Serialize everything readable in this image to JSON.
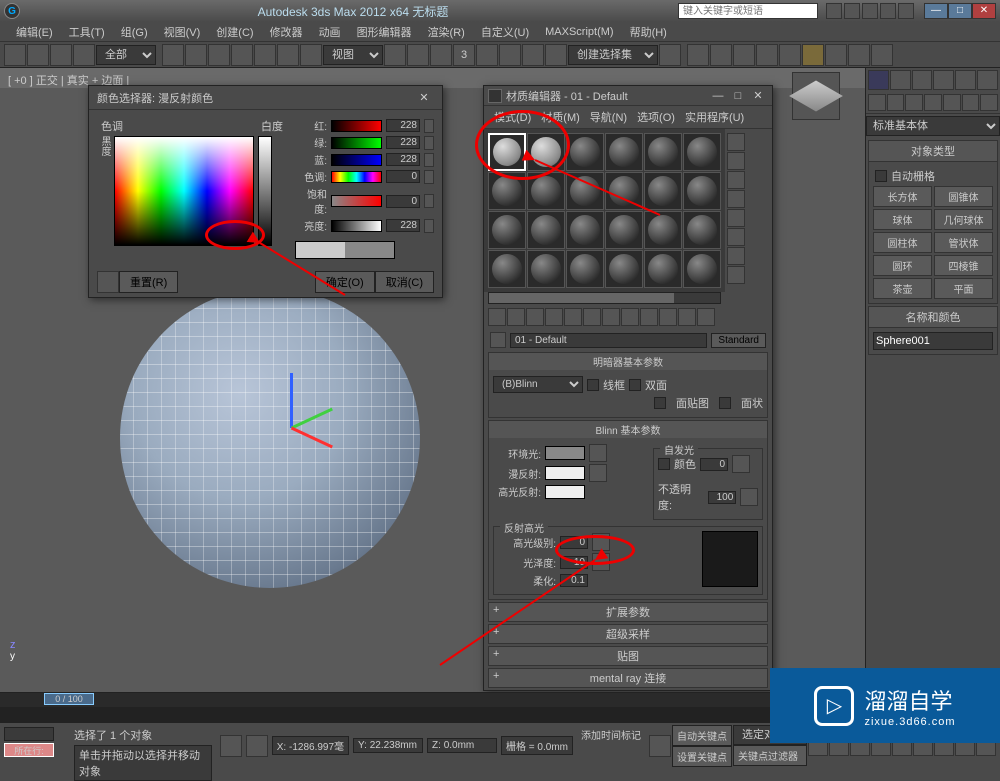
{
  "title_bar": {
    "app_title": "Autodesk 3ds Max 2012 x64   无标题",
    "search_placeholder": "键入关键字或短语"
  },
  "menu": [
    "编辑(E)",
    "工具(T)",
    "组(G)",
    "视图(V)",
    "创建(C)",
    "修改器",
    "动画",
    "图形编辑器",
    "渲染(R)",
    "自定义(U)",
    "MAXScript(M)",
    "帮助(H)"
  ],
  "toolbar": {
    "selection_set": "全部",
    "view_label": "视图",
    "create_set_label": "创建选择集"
  },
  "viewport": {
    "label": "[ +0 ] 正交 | 真实 + 边面 |"
  },
  "color_picker": {
    "title": "颜色选择器: 漫反射颜色",
    "hue_label": "色调",
    "whiteness_label": "白度",
    "blackness_label": "黑度",
    "sliders": {
      "red": {
        "label": "红:",
        "value": "228"
      },
      "green": {
        "label": "绿:",
        "value": "228"
      },
      "blue": {
        "label": "蓝:",
        "value": "228"
      },
      "hue": {
        "label": "色调:",
        "value": "0"
      },
      "sat": {
        "label": "饱和度:",
        "value": "0"
      },
      "val": {
        "label": "亮度:",
        "value": "228"
      }
    },
    "reset": "重置(R)",
    "ok": "确定(O)",
    "cancel": "取消(C)"
  },
  "material_editor": {
    "title": "材质编辑器 - 01 - Default",
    "menu": [
      "模式(D)",
      "材质(M)",
      "导航(N)",
      "选项(O)",
      "实用程序(U)"
    ],
    "mat_name": "01 - Default",
    "type_btn": "Standard",
    "rollouts": {
      "shader": {
        "title": "明暗器基本参数",
        "shader_type": "(B)Blinn",
        "wire": "线框",
        "two_sided": "双面",
        "face_map": "面贴图",
        "faceted": "面状"
      },
      "blinn": {
        "title": "Blinn 基本参数",
        "self_illum_group": "自发光",
        "color_check": "颜色",
        "ambient": "环境光:",
        "diffuse": "漫反射:",
        "specular": "高光反射:",
        "opacity": "不透明度:",
        "opacity_val": "100",
        "self_illum_val": "0",
        "spec_group": "反射高光",
        "spec_level": "高光级别:",
        "spec_level_val": "0",
        "glossiness": "光泽度:",
        "glossiness_val": "10",
        "soften": "柔化:",
        "soften_val": "0.1"
      },
      "extended": "扩展参数",
      "supersample": "超级采样",
      "maps": "贴图",
      "mental_ray": "mental ray 连接"
    }
  },
  "command_panel": {
    "category": "标准基本体",
    "object_type": "对象类型",
    "autogrid": "自动栅格",
    "primitives": [
      "长方体",
      "圆锥体",
      "球体",
      "几何球体",
      "圆柱体",
      "管状体",
      "圆环",
      "四棱锥",
      "茶壶",
      "平面"
    ],
    "name_color": "名称和颜色",
    "object_name": "Sphere001"
  },
  "timeline": {
    "slider": "0 / 100"
  },
  "status": {
    "selected": "选择了 1 个对象",
    "prompt": "单击并拖动以选择并移动对象",
    "x": "X: -1286.997毫",
    "y": "Y: 22.238mm",
    "z": "Z: 0.0mm",
    "grid": "栅格 = 0.0mm",
    "autokey": "自动关键点",
    "selected_obj": "选定对象",
    "set_key": "设置关键点",
    "key_filters": "关键点过滤器",
    "add_time_tag": "添加时间标记",
    "here": "所在行:"
  },
  "watermark": {
    "name": "溜溜自学",
    "url": "zixue.3d66.com"
  }
}
